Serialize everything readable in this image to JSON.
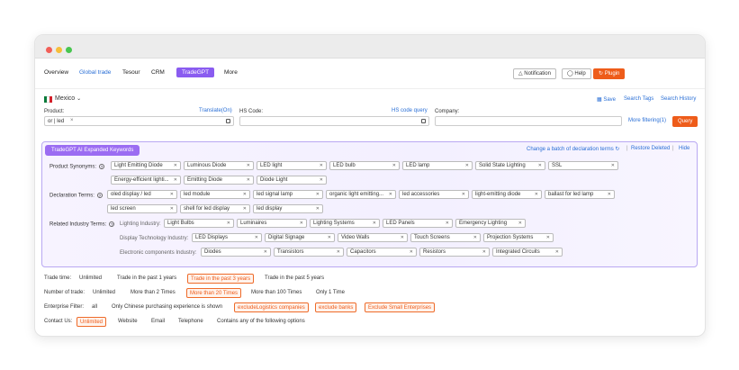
{
  "nav": {
    "items": [
      "Overview",
      "Global trade",
      "Tesour",
      "CRM",
      "TradeGPT",
      "More"
    ],
    "active": "TradeGPT",
    "notification": "Notification",
    "help": "Help",
    "plugin": "Plugin"
  },
  "country": {
    "name": "Mexico",
    "save": "Save",
    "search_tags": "Search Tags",
    "search_history": "Search History"
  },
  "search": {
    "product_label": "Product:",
    "translate": "Translate(On)",
    "product_value": "or | led",
    "hs_label": "HS Code:",
    "hs_query": "HS code query",
    "company_label": "Company:",
    "more_filtering": "More filtering(1)",
    "query": "Query"
  },
  "ai": {
    "title": "TradeGPT AI Expanded Keywords",
    "change_batch": "Change a batch of declaration terms",
    "restore": "Restore Deleted",
    "hide": "Hide",
    "product_synonyms_label": "Product Synonyms:",
    "product_synonyms": [
      "Light Emitting Diode",
      "Luminous Diode",
      "LED light",
      "LED bulb",
      "LED lamp",
      "Solid State Lighting",
      "SSL",
      "Energy-efficient lighti...",
      "Emitting Diode",
      "Diode Light"
    ],
    "declaration_label": "Declaration Terms:",
    "declaration_terms": [
      "oled display / led",
      "led module",
      "led signal lamp",
      "organic light emitting...",
      "led accessories",
      "light-emitting diode",
      "ballast for led lamp",
      "led screen",
      "shell for led display",
      "led display"
    ],
    "related_label": "Related Industry Terms:",
    "lighting_label": "Lighting Industry:",
    "lighting": [
      "Light Bulbs",
      "Luminaires",
      "Lighting Systems",
      "LED Panels",
      "Emergency Lighting"
    ],
    "display_label": "Display Technology Industry:",
    "display": [
      "LED Displays",
      "Digital Signage",
      "Video Walls",
      "Touch Screens",
      "Projection Systems"
    ],
    "electronic_label": "Electronic components Industry:",
    "electronic": [
      "Diodes",
      "Transistors",
      "Capacitors",
      "Resistors",
      "Integrated Circuits"
    ]
  },
  "filters": {
    "trade_time_label": "Trade time:",
    "trade_time": [
      "Unlimited",
      "Trade in the past 1 years",
      "Trade in the past 3 years",
      "Trade in the past 5 years"
    ],
    "trade_time_selected": "Trade in the past 3 years",
    "number_label": "Number of trade:",
    "number": [
      "Unlimited",
      "More than 2 Times",
      "More than 20 Times",
      "More than 100 Times",
      "Only 1 Time"
    ],
    "number_selected": "More than 20 Times",
    "enterprise_label": "Enterprise Filter:",
    "enterprise": [
      "all",
      "Only Chinese purchasing experience is shown",
      "excludeLogistics companies",
      "exclude banks",
      "Exclude Small Enterprises"
    ],
    "contact_label": "Contact Us:",
    "contact": [
      "Unlimited",
      "Website",
      "Email",
      "Telephone",
      "Contains any of the following options"
    ],
    "contact_selected": "Unlimited"
  },
  "colors": {
    "accent": "#ee5c1a",
    "purple": "#8a5cf0",
    "link": "#2a6fd6"
  }
}
